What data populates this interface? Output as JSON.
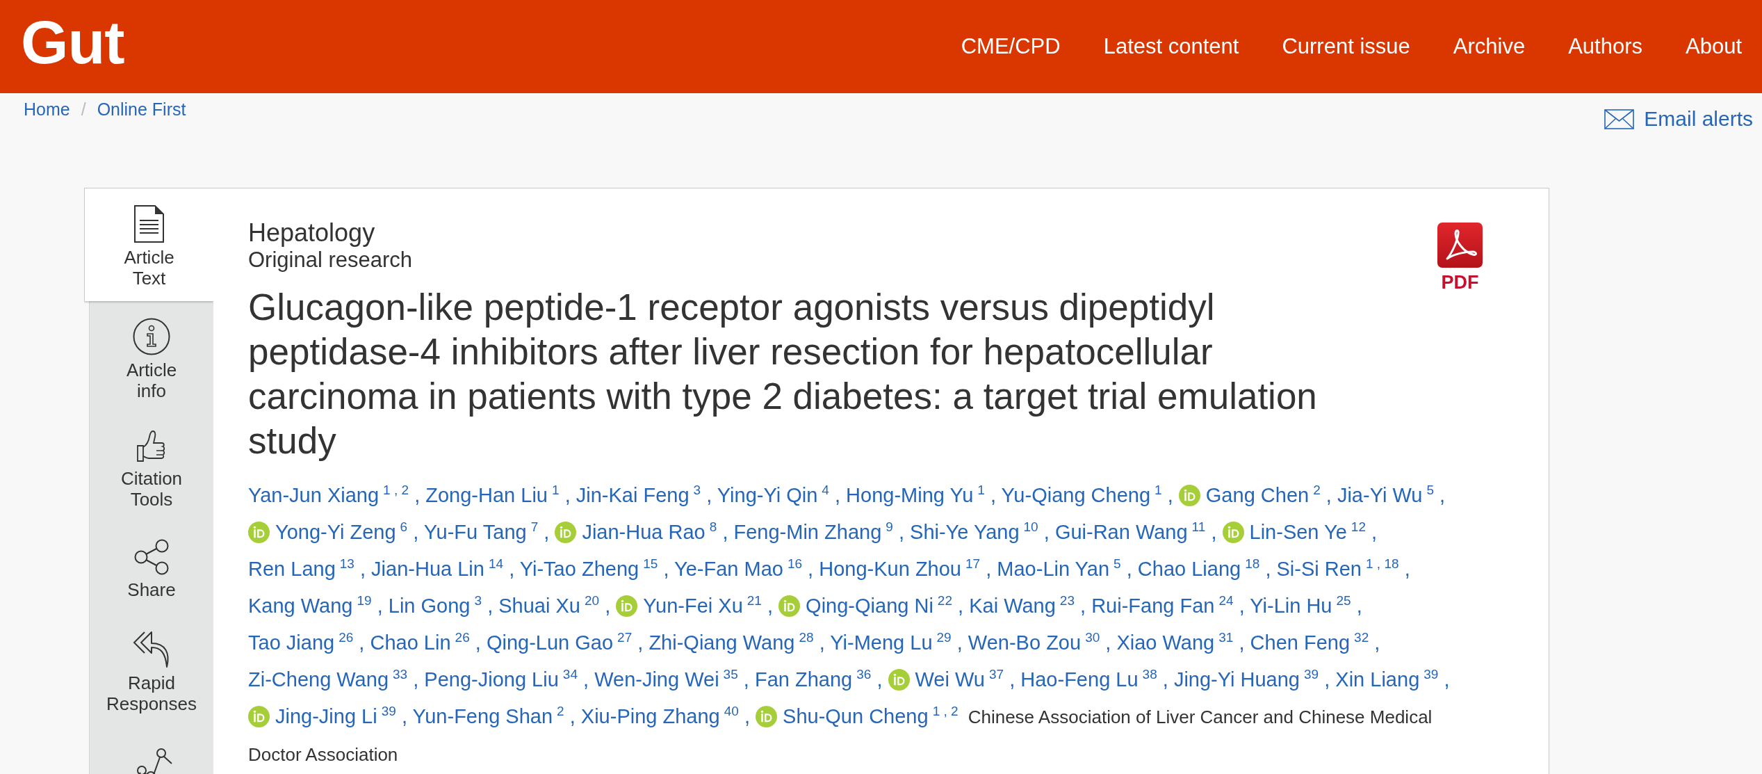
{
  "header": {
    "logo": "Gut",
    "nav": [
      "CME/CPD",
      "Latest content",
      "Current issue",
      "Archive",
      "Authors",
      "About"
    ]
  },
  "breadcrumb": {
    "items": [
      "Home",
      "Online First"
    ],
    "separator": "/"
  },
  "email_alerts": {
    "label": "Email alerts"
  },
  "sidebar": {
    "items": [
      {
        "label": "Article Text",
        "selected": true
      },
      {
        "label": "Article info",
        "selected": false
      },
      {
        "label": "Citation Tools",
        "selected": false
      },
      {
        "label": "Share",
        "selected": false
      },
      {
        "label": "Rapid Responses",
        "selected": false
      },
      {
        "selected": false
      }
    ]
  },
  "article": {
    "subject": "Hepatology",
    "type": "Original research",
    "title": "Glucagon-like peptide-1 receptor agonists versus dipeptidyl peptidase-4 inhibitors after liver resection for hepatocellular carcinoma in patients with type 2 diabetes: a target trial emulation study",
    "pdf": {
      "label": "PDF"
    },
    "authors": [
      {
        "name": "Yan-Jun Xiang",
        "affiliations": "1 , 2",
        "orcid": false,
        "separator": ","
      },
      {
        "name": "Zong-Han Liu",
        "affiliations": "1",
        "orcid": false,
        "separator": ","
      },
      {
        "name": "Jin-Kai Feng",
        "affiliations": "3",
        "orcid": false,
        "separator": ","
      },
      {
        "name": "Ying-Yi Qin",
        "affiliations": "4",
        "orcid": false,
        "separator": ","
      },
      {
        "name": "Hong-Ming Yu",
        "affiliations": "1",
        "orcid": false,
        "separator": ","
      },
      {
        "name": "Yu-Qiang Cheng",
        "affiliations": "1",
        "orcid": false,
        "separator": ","
      },
      {
        "name": "Gang Chen",
        "affiliations": "2",
        "orcid": true,
        "separator": ","
      },
      {
        "name": "Jia-Yi Wu",
        "affiliations": "5",
        "orcid": false,
        "separator": ","
      },
      {
        "name": "Yong-Yi Zeng",
        "affiliations": "6",
        "orcid": true,
        "separator": ","
      },
      {
        "name": "Yu-Fu Tang",
        "affiliations": "7",
        "orcid": false,
        "separator": ","
      },
      {
        "name": "Jian-Hua Rao",
        "affiliations": "8",
        "orcid": true,
        "separator": ","
      },
      {
        "name": "Feng-Min Zhang",
        "affiliations": "9",
        "orcid": false,
        "separator": ","
      },
      {
        "name": "Shi-Ye Yang",
        "affiliations": "10",
        "orcid": false,
        "separator": ","
      },
      {
        "name": "Gui-Ran Wang",
        "affiliations": "11",
        "orcid": false,
        "separator": ","
      },
      {
        "name": "Lin-Sen Ye",
        "affiliations": "12",
        "orcid": true,
        "separator": ","
      },
      {
        "name": "Ren Lang",
        "affiliations": "13",
        "orcid": false,
        "separator": ","
      },
      {
        "name": "Jian-Hua Lin",
        "affiliations": "14",
        "orcid": false,
        "separator": ","
      },
      {
        "name": "Yi-Tao Zheng",
        "affiliations": "15",
        "orcid": false,
        "separator": ","
      },
      {
        "name": "Ye-Fan Mao",
        "affiliations": "16",
        "orcid": false,
        "separator": ","
      },
      {
        "name": "Hong-Kun Zhou",
        "affiliations": "17",
        "orcid": false,
        "separator": ","
      },
      {
        "name": "Mao-Lin Yan",
        "affiliations": "5",
        "orcid": false,
        "separator": ","
      },
      {
        "name": "Chao Liang",
        "affiliations": "18",
        "orcid": false,
        "separator": ","
      },
      {
        "name": "Si-Si Ren",
        "affiliations": "1 , 18",
        "orcid": false,
        "separator": ","
      },
      {
        "name": "Kang Wang",
        "affiliations": "19",
        "orcid": false,
        "separator": ","
      },
      {
        "name": "Lin Gong",
        "affiliations": "3",
        "orcid": false,
        "separator": ","
      },
      {
        "name": "Shuai Xu",
        "affiliations": "20",
        "orcid": false,
        "separator": ","
      },
      {
        "name": "Yun-Fei Xu",
        "affiliations": "21",
        "orcid": true,
        "separator": ","
      },
      {
        "name": "Qing-Qiang Ni",
        "affiliations": "22",
        "orcid": true,
        "separator": ","
      },
      {
        "name": "Kai Wang",
        "affiliations": "23",
        "orcid": false,
        "separator": ","
      },
      {
        "name": "Rui-Fang Fan",
        "affiliations": "24",
        "orcid": false,
        "separator": ","
      },
      {
        "name": "Yi-Lin Hu",
        "affiliations": "25",
        "orcid": false,
        "separator": ","
      },
      {
        "name": "Tao Jiang",
        "affiliations": "26",
        "orcid": false,
        "separator": ","
      },
      {
        "name": "Chao Lin",
        "affiliations": "26",
        "orcid": false,
        "separator": ","
      },
      {
        "name": "Qing-Lun Gao",
        "affiliations": "27",
        "orcid": false,
        "separator": ","
      },
      {
        "name": "Zhi-Qiang Wang",
        "affiliations": "28",
        "orcid": false,
        "separator": ","
      },
      {
        "name": "Yi-Meng Lu",
        "affiliations": "29",
        "orcid": false,
        "separator": ","
      },
      {
        "name": "Wen-Bo Zou",
        "affiliations": "30",
        "orcid": false,
        "separator": ","
      },
      {
        "name": "Xiao Wang",
        "affiliations": "31",
        "orcid": false,
        "separator": ","
      },
      {
        "name": "Chen Feng",
        "affiliations": "32",
        "orcid": false,
        "separator": ","
      },
      {
        "name": "Zi-Cheng Wang",
        "affiliations": "33",
        "orcid": false,
        "separator": ","
      },
      {
        "name": "Peng-Jiong Liu",
        "affiliations": "34",
        "orcid": false,
        "separator": ","
      },
      {
        "name": "Wen-Jing Wei",
        "affiliations": "35",
        "orcid": false,
        "separator": ","
      },
      {
        "name": "Fan Zhang",
        "affiliations": "36",
        "orcid": false,
        "separator": ","
      },
      {
        "name": "Wei Wu",
        "affiliations": "37",
        "orcid": true,
        "separator": ","
      },
      {
        "name": "Hao-Feng Lu",
        "affiliations": "38",
        "orcid": false,
        "separator": ","
      },
      {
        "name": "Jing-Yi Huang",
        "affiliations": "39",
        "orcid": false,
        "separator": ","
      },
      {
        "name": "Xin Liang",
        "affiliations": "39",
        "orcid": false,
        "separator": ","
      },
      {
        "name": "Jing-Jing Li",
        "affiliations": "39",
        "orcid": true,
        "separator": ","
      },
      {
        "name": "Yun-Feng Shan",
        "affiliations": "2",
        "orcid": false,
        "separator": ","
      },
      {
        "name": "Xiu-Ping Zhang",
        "affiliations": "40",
        "orcid": false,
        "separator": ","
      },
      {
        "name": "Shu-Qun Cheng",
        "affiliations": "1 , 2",
        "orcid": true
      }
    ],
    "group_author": "Chinese Association of Liver Cancer and Chinese Medical Doctor Association"
  }
}
